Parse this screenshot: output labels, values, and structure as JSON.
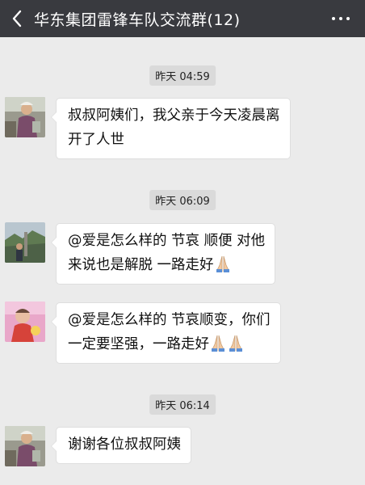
{
  "header": {
    "title": "华东集团雷锋车队交流群(12)",
    "back_icon": "chevron-left-icon",
    "more_icon": "more-dots-icon"
  },
  "messages": [
    {
      "time": "昨天 04:59"
    },
    {
      "lines": [
        "叔叔阿姨们，我父亲于今天凌晨离",
        "开了人世"
      ]
    },
    {
      "time": "昨天 06:09"
    },
    {
      "lines": [
        "@爱是怎么样的  节哀 顺便  对他",
        "来说也是解脱  一路走好"
      ],
      "emoji": "🙏"
    },
    {
      "lines": [
        "@爱是怎么样的  节哀顺变，你们",
        "一定要坚强，一路走好"
      ],
      "emoji": "🙏🙏"
    },
    {
      "time": "昨天 06:14"
    },
    {
      "lines": [
        "谢谢各位叔叔阿姨"
      ]
    }
  ]
}
